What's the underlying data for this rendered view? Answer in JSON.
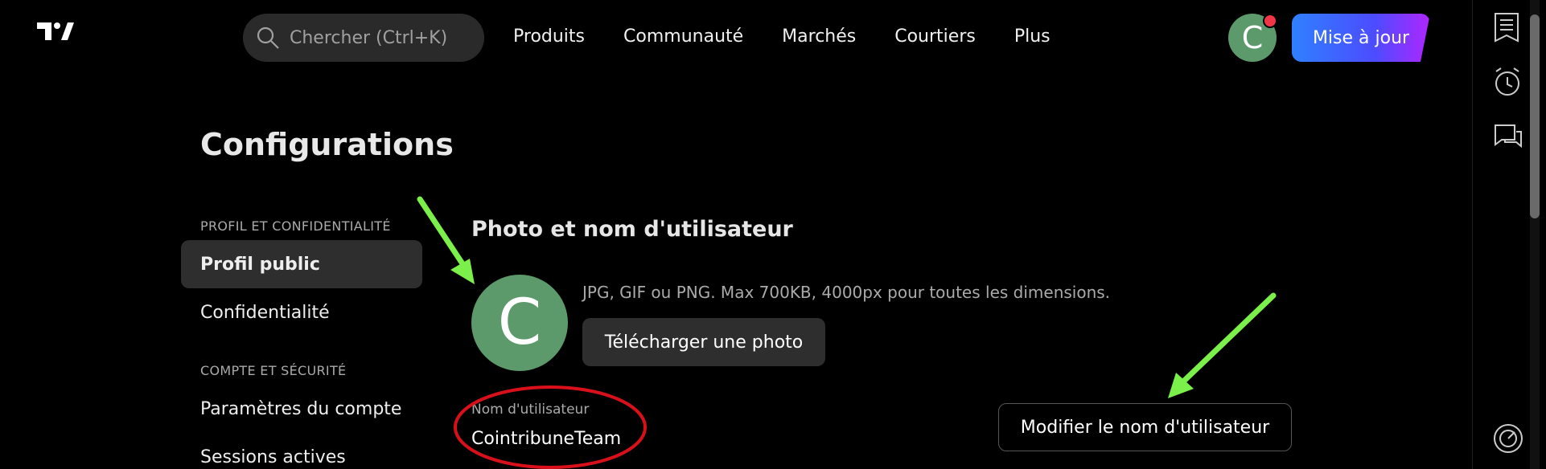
{
  "header": {
    "search_placeholder": "Chercher (Ctrl+K)",
    "nav": [
      "Produits",
      "Communauté",
      "Marchés",
      "Courtiers",
      "Plus"
    ],
    "avatar_letter": "C",
    "upgrade_label": "Mise à jour"
  },
  "page": {
    "title": "Configurations"
  },
  "sidebar": {
    "section1": "PROFIL ET CONFIDENTIALITÉ",
    "items1": [
      "Profil public",
      "Confidentialité"
    ],
    "section2": "COMPTE ET SÉCURITÉ",
    "items2": [
      "Paramètres du compte",
      "Sessions actives"
    ]
  },
  "main": {
    "heading": "Photo et nom d'utilisateur",
    "avatar_letter": "C",
    "hint": "JPG, GIF ou PNG. Max 700KB, 4000px pour toutes les dimensions.",
    "upload_label": "Télécharger une photo",
    "username_label": "Nom d'utilisateur",
    "username_value": "CointribuneTeam",
    "edit_label": "Modifier le nom d'utilisateur"
  },
  "colors": {
    "avatar": "#5c9a6c",
    "annotation_arrow": "#7cf04a",
    "annotation_circle": "#d9101a",
    "notification_dot": "#f23645"
  },
  "icons": [
    "tradingview-logo",
    "search-icon",
    "watchlist-icon",
    "alarm-clock-icon",
    "chat-icon",
    "speedometer-icon"
  ]
}
